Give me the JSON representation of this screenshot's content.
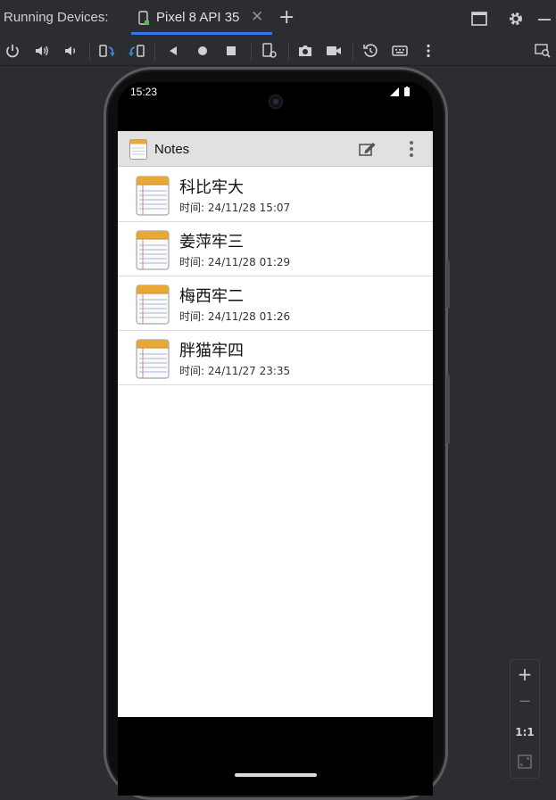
{
  "ide": {
    "panel_title": "Running Devices:",
    "device_tab_label": "Pixel 8 API 35",
    "close_glyph": "✕",
    "add_glyph": "+"
  },
  "phone": {
    "status_time": "15:23"
  },
  "app": {
    "title": "Notes",
    "notes": [
      {
        "title": "科比牢大",
        "time": "时间: 24/11/28 15:07"
      },
      {
        "title": "姜萍牢三",
        "time": "时间: 24/11/28 01:29"
      },
      {
        "title": "梅西牢二",
        "time": "时间: 24/11/28 01:26"
      },
      {
        "title": "胖猫牢四",
        "time": "时间: 24/11/27 23:35"
      }
    ]
  },
  "zoom": {
    "zoom_in": "+",
    "zoom_out": "−",
    "actual_size": "1:1"
  },
  "colors": {
    "ide_bg": "#2b2d30",
    "tab_accent": "#3574f0",
    "actionbar_bg": "#e1e1e1"
  }
}
